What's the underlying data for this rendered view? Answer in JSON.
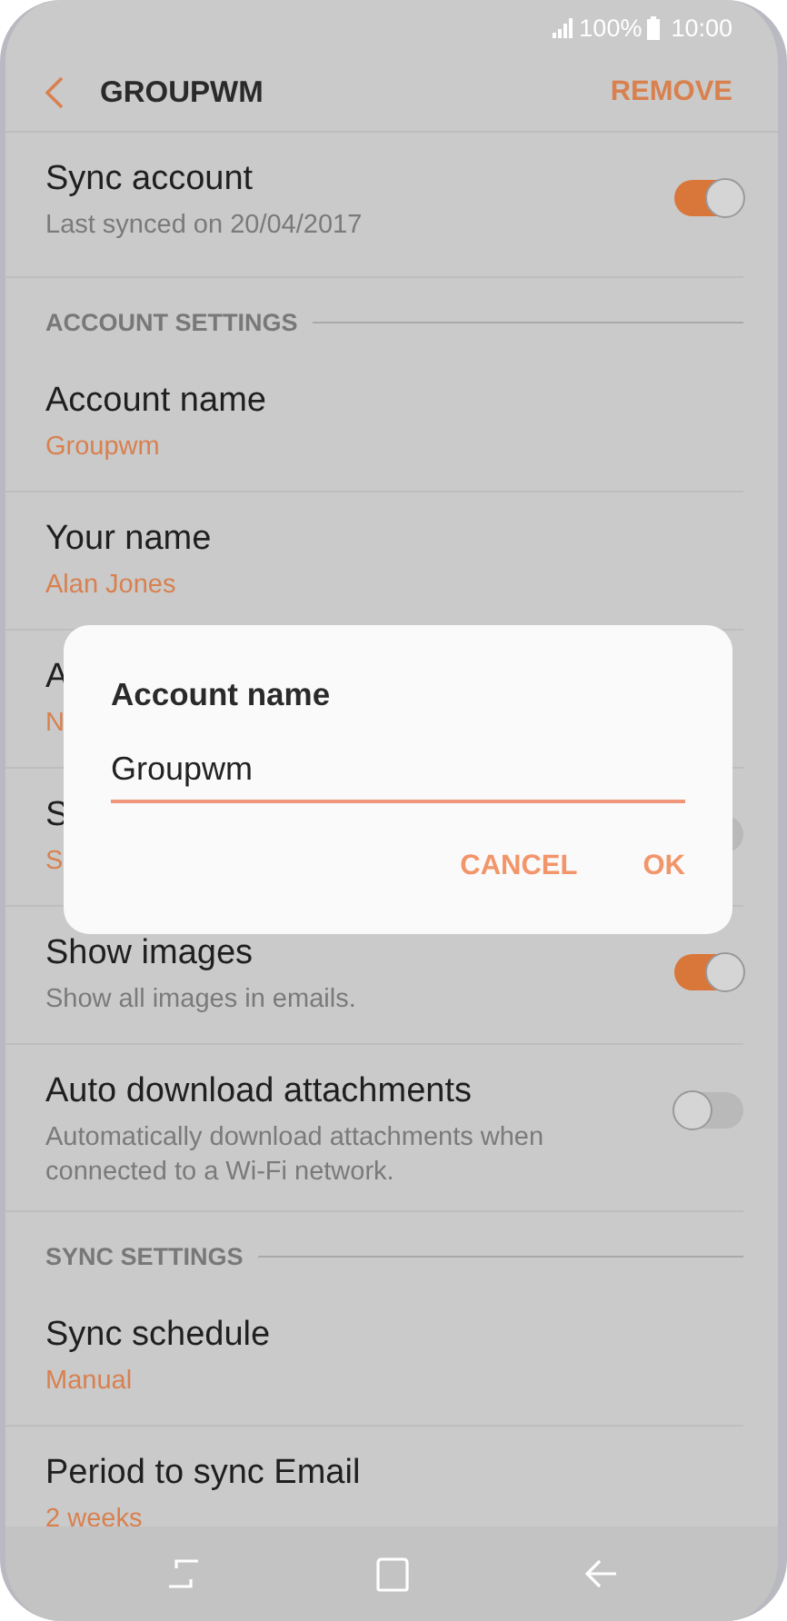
{
  "status_bar": {
    "battery": "100%",
    "time": "10:00"
  },
  "header": {
    "title": "GROUPWM",
    "action": "REMOVE"
  },
  "items": [
    {
      "kind": "row",
      "title": "Sync account",
      "subtitle": "Last synced on 20/04/2017",
      "accent": false,
      "toggle": {
        "on": true
      }
    },
    {
      "kind": "section",
      "title": "ACCOUNT SETTINGS"
    },
    {
      "kind": "row",
      "title": "Account name",
      "subtitle": "Groupwm",
      "accent": true
    },
    {
      "kind": "row",
      "title": "Your name",
      "subtitle": "Alan Jones",
      "accent": true
    },
    {
      "kind": "row",
      "title": "A",
      "subtitle": "N",
      "accent": true
    },
    {
      "kind": "row",
      "title": "S",
      "subtitle": "S",
      "accent": true,
      "toggle": {
        "on": false
      }
    },
    {
      "kind": "row",
      "title": "Show images",
      "subtitle": "Show all images in emails.",
      "accent": false,
      "toggle": {
        "on": true
      }
    },
    {
      "kind": "row",
      "title": "Auto download attachments",
      "subtitle": "Automatically download attachments when connected to a Wi-Fi network.",
      "accent": false,
      "toggle": {
        "on": false
      }
    },
    {
      "kind": "section",
      "title": "SYNC SETTINGS"
    },
    {
      "kind": "row",
      "title": "Sync schedule",
      "subtitle": "Manual",
      "accent": true
    },
    {
      "kind": "row",
      "title": "Period to sync Email",
      "subtitle": "2 weeks",
      "accent": true
    }
  ],
  "dialog": {
    "title": "Account name",
    "value": "Groupwm",
    "buttons": [
      "CANCEL",
      "OK"
    ]
  }
}
